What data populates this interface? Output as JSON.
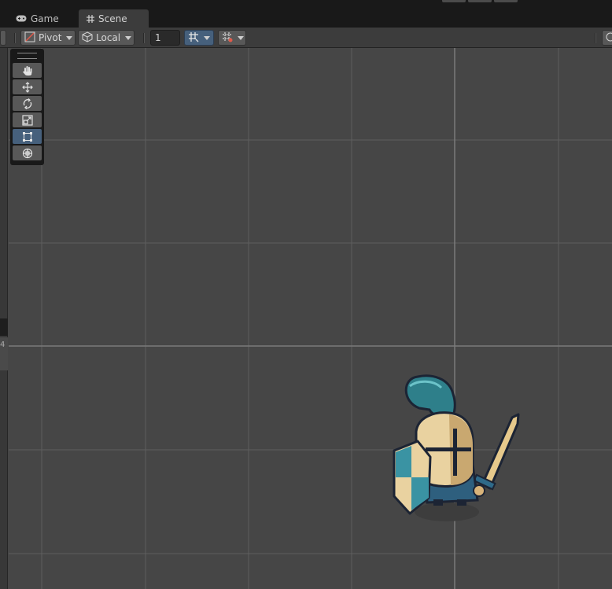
{
  "tabs": [
    {
      "label": "Game",
      "icon": "gamepad-icon",
      "active": false
    },
    {
      "label": "Scene",
      "icon": "hash-icon",
      "active": true
    }
  ],
  "toolbar": {
    "pivot_label": "Pivot",
    "local_label": "Local",
    "grid_snap_value": "1"
  },
  "tools": [
    {
      "name": "hand-tool",
      "icon": "hand-icon",
      "active": false
    },
    {
      "name": "move-tool",
      "icon": "move-arrows-icon",
      "active": false
    },
    {
      "name": "rotate-tool",
      "icon": "rotate-icon",
      "active": false
    },
    {
      "name": "scale-tool",
      "icon": "scale-icon",
      "active": false
    },
    {
      "name": "rect-tool",
      "icon": "rect-transform-icon",
      "active": true
    },
    {
      "name": "transform-tool",
      "icon": "transform-icon",
      "active": false
    }
  ],
  "left_panel": {
    "partial_text": "4"
  },
  "colors": {
    "background": "#464646",
    "grid_line": "#5e5e5e",
    "axis_line": "#7a7a7a",
    "accent": "#46607c"
  }
}
